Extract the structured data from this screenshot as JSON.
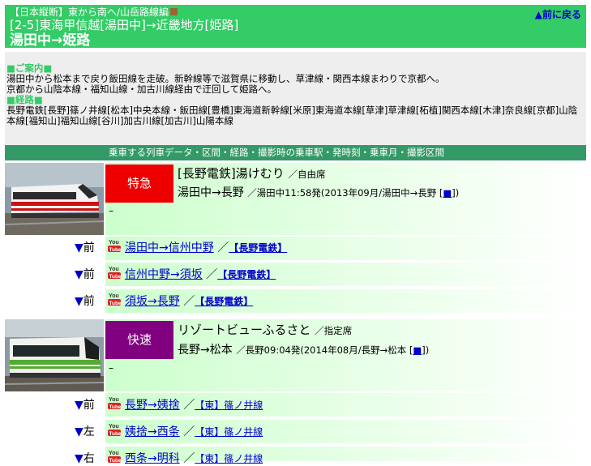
{
  "header": {
    "line1": "【日本縦断】東から南へ/山岳路線編",
    "line2": "[2-5]東海甲信越[湯田中]→近畿地方[姫路]",
    "line3": "湯田中→姫路",
    "back_link": "▲前に戻る",
    "colors": {
      "background": "#33cc66",
      "accent_square": "#996633"
    }
  },
  "info": {
    "guide_heading": "■ご案内■",
    "guide_line1": "湯田中から松本まで戻り飯田線を走破。新幹線等で滋賀県に移動し、草津線・関西本線まわりで京都へ。",
    "guide_line2": "京都から山陰本線・福知山線・加古川線経由で迂回して姫路へ。",
    "route_heading": "■経路■",
    "route_text": "長野電鉄[長野]篠ノ井線[松本]中央本線・飯田線[豊橋]東海道新幹線[米原]東海道本線[草津]草津線[柘植]関西本線[木津]奈良線[京都]山陰本線[福知山]福知山線[谷川]加古川線[加古川]山陽本線"
  },
  "table_header": "乗車する列車データ・区間・経路・撮影時の乗車駅・発時刻・乗車月・撮影区間",
  "trains": [
    {
      "badge": "特急",
      "badge_color": "#ee0000",
      "name": "[長野電鉄]湯けむり",
      "seat": "／自由席",
      "route": "湯田中→長野",
      "detail": "／湯田中11:58発(2013年09月/湯田中→長野 [",
      "detail_end": "])",
      "square": "■",
      "dash": "–",
      "segments": [
        {
          "dir_arrow": "▼",
          "dir": "前",
          "link": "湯田中→信州中野",
          "sep": "／",
          "op": "【長野電鉄】"
        },
        {
          "dir_arrow": "▼",
          "dir": "前",
          "link": "信州中野→須坂",
          "sep": "／",
          "op": "【長野電鉄】"
        },
        {
          "dir_arrow": "▼",
          "dir": "前",
          "link": "須坂→長野",
          "sep": "／",
          "op": "【長野電鉄】"
        }
      ]
    },
    {
      "badge": "快速",
      "badge_color": "#800080",
      "name": "リゾートビューふるさと",
      "seat": "／指定席",
      "route": "長野→松本",
      "detail": "／長野09:04発(2014年08月/長野→松本 [",
      "detail_end": "])",
      "square": "■",
      "dash": "–",
      "segments": [
        {
          "dir_arrow": "▼",
          "dir": "前",
          "link": "長野→姨捨",
          "sep": "／",
          "op": "【東】篠ノ井線"
        },
        {
          "dir_arrow": "▼",
          "dir": "左",
          "link": "姨捨→西条",
          "sep": "／",
          "op": "【東】篠ノ井線"
        },
        {
          "dir_arrow": "▼",
          "dir": "右",
          "link": "西条→明科",
          "sep": "／",
          "op": "【東】篠ノ井線"
        }
      ]
    }
  ],
  "icons": {
    "youtube": "youtube-icon"
  }
}
